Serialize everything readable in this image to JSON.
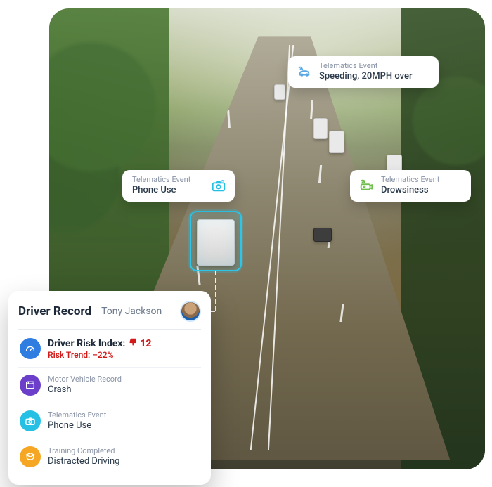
{
  "callouts": {
    "speeding": {
      "label": "Telematics Event",
      "value": "Speeding, 20MPH over"
    },
    "phone": {
      "label": "Telematics Event",
      "value": "Phone Use"
    },
    "drowsiness": {
      "label": "Telematics Event",
      "value": "Drowsiness"
    }
  },
  "driver_card": {
    "title": "Driver Record",
    "name": "Tony Jackson",
    "risk": {
      "label": "Driver Risk Index:",
      "score": "12",
      "trend_label": "Risk Trend:",
      "trend_value": "–22%"
    },
    "items": [
      {
        "caption": "Motor Vehicle Record",
        "value": "Crash"
      },
      {
        "caption": "Telematics Event",
        "value": "Phone Use"
      },
      {
        "caption": "Training Completed",
        "value": "Distracted Driving"
      }
    ]
  },
  "colors": {
    "focus": "#2ec5e6",
    "risk": "#d11a1a"
  }
}
